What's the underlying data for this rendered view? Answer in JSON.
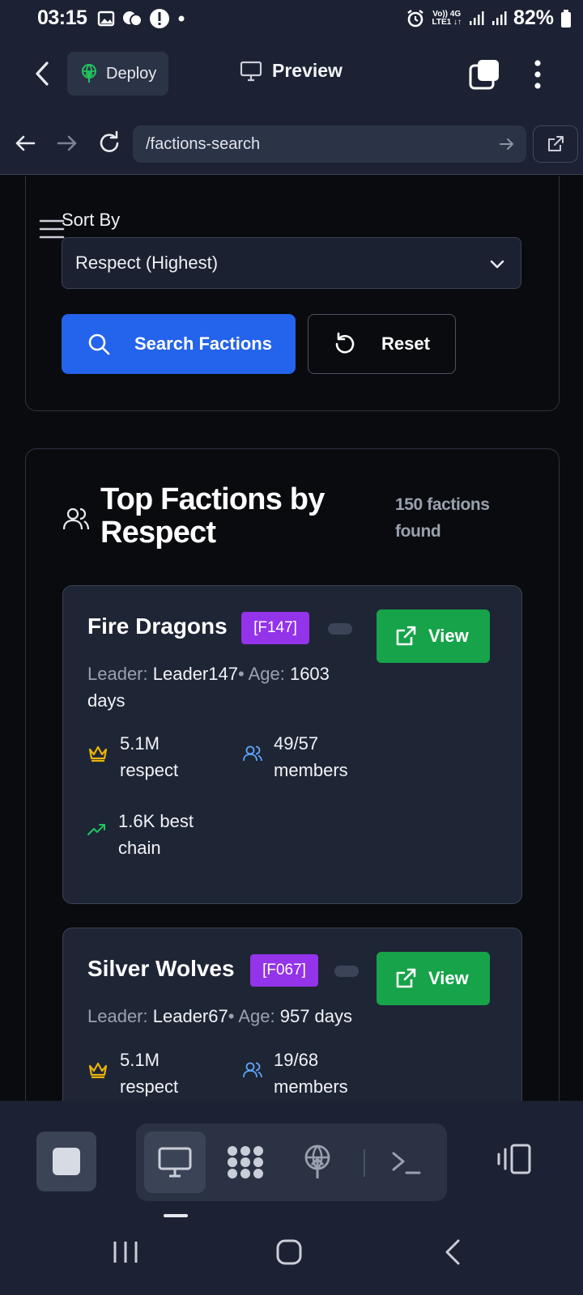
{
  "status_bar": {
    "time": "03:15",
    "network_top": "Vo)) 4G",
    "network_bottom": "LTE1 ↓↑",
    "battery": "82%"
  },
  "app_bar": {
    "deploy_label": "Deploy",
    "preview_label": "Preview"
  },
  "url_bar": {
    "url": "/factions-search"
  },
  "filters": {
    "sort_label": "Sort By",
    "sort_value": "Respect (Highest)",
    "search_button": "Search Factions",
    "reset_button": "Reset"
  },
  "results": {
    "title": "Top Factions by Respect",
    "count_text": "150 factions found",
    "view_label": "View",
    "leader_prefix": "Leader:",
    "age_prefix": "• Age:",
    "factions": [
      {
        "name": "Fire Dragons",
        "tag": "[F147]",
        "leader": "Leader147",
        "age": "1603 days",
        "respect": "5.1M respect",
        "members": "49/57 members",
        "best_chain": "1.6K best chain"
      },
      {
        "name": "Silver Wolves",
        "tag": "[F067]",
        "leader": "Leader67",
        "age": "957 days",
        "respect": "5.1M respect",
        "members": "19/68 members"
      }
    ]
  },
  "colors": {
    "primary": "#2463eb",
    "view": "#16a34a",
    "tag": "#9333ea",
    "crown": "#eab308",
    "members_icon": "#60a5fa",
    "chain_icon": "#22c55e"
  },
  "icons": {
    "toolbar": [
      "stop-icon",
      "monitor-icon",
      "workflow-icon",
      "deploy-icon",
      "terminal-icon",
      "panel-icon"
    ]
  }
}
